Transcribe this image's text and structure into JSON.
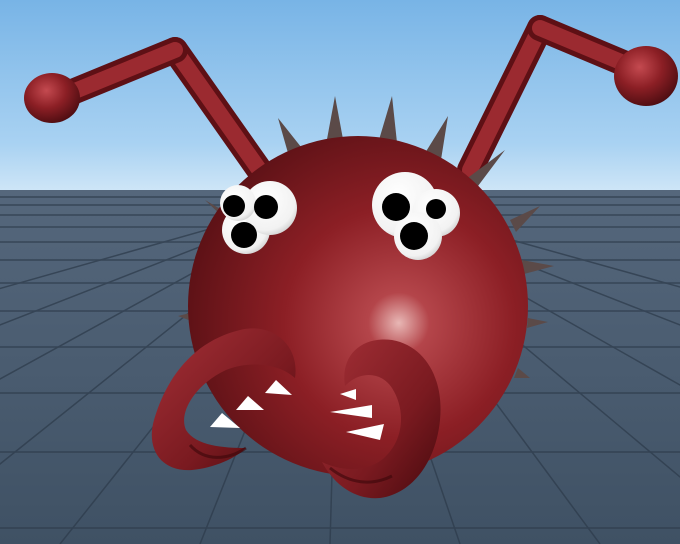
{
  "scene": {
    "type": "3d-game-viewport",
    "colors": {
      "sky_top": "#78b4e6",
      "sky_horizon": "#cfe6f7",
      "ground_near": "#3f5164",
      "ground_far": "#55677c",
      "grid_line": "#2e3c4c",
      "creature_body": "#8c1f25",
      "creature_dark": "#4a0c10",
      "creature_highlight": "#e0aaa8",
      "spike": "#5b4a48",
      "eye_white": "#ffffff",
      "pupil": "#000000",
      "fang": "#ffffff"
    },
    "icons": {
      "creature": "red-spiky-ball-creature-icon",
      "antenna": "antenna-icon",
      "eye": "googly-eye-icon",
      "mandible": "pincer-mandible-icon",
      "fang": "fang-icon"
    }
  }
}
